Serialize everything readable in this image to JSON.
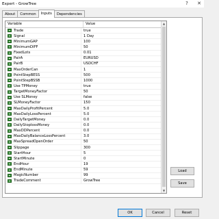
{
  "window": {
    "title": "Expert - GrowTree"
  },
  "tabs": [
    {
      "label": "About"
    },
    {
      "label": "Common"
    },
    {
      "label": "Inputs"
    },
    {
      "label": "Dependencies"
    }
  ],
  "grid": {
    "columns": [
      "Variable",
      "Value"
    ],
    "rows": [
      {
        "name": "Trade",
        "value": "true"
      },
      {
        "name": "Signal",
        "value": "1 Day"
      },
      {
        "name": "MinimumGAP",
        "value": "100"
      },
      {
        "name": "MinimumDIFF",
        "value": "50"
      },
      {
        "name": "FixedLots",
        "value": "0.01"
      },
      {
        "name": "PairA",
        "value": "EURUSD"
      },
      {
        "name": "PairB",
        "value": "USDCHF"
      },
      {
        "name": "MaxOrderCan",
        "value": "1"
      },
      {
        "name": "PointStepBESS",
        "value": "500"
      },
      {
        "name": "PointStepBSSB",
        "value": "1000"
      },
      {
        "name": "Use TPMoney",
        "value": "true"
      },
      {
        "name": "TargetMoneyFactor",
        "value": "50"
      },
      {
        "name": "Use SLMoney",
        "value": "false"
      },
      {
        "name": "SLMoneyFactor",
        "value": "150"
      },
      {
        "name": "MaxDailyProfitPercent",
        "value": "5.0"
      },
      {
        "name": "MaxDailyLossPercent",
        "value": "5.0"
      },
      {
        "name": "DailyTargetMoney",
        "value": "0.0"
      },
      {
        "name": "DailyStoplossMoney",
        "value": "0.0"
      },
      {
        "name": "MaxDDPercent",
        "value": "0.0"
      },
      {
        "name": "MaxDailyBalanceLossPercent",
        "value": "3.0"
      },
      {
        "name": "MaxSpreadOpenOrder",
        "value": "50"
      },
      {
        "name": "Slippage",
        "value": "300"
      },
      {
        "name": "StartHour",
        "value": "5"
      },
      {
        "name": "StartMinute",
        "value": "0"
      },
      {
        "name": "EndHour",
        "value": "19"
      },
      {
        "name": "EndMinute",
        "value": "59"
      },
      {
        "name": "MagicNumber",
        "value": "99"
      },
      {
        "name": "TradeComment",
        "value": "GrowTree"
      }
    ]
  },
  "side_buttons": {
    "load": "Load",
    "save": "Save"
  },
  "bottom_buttons": {
    "ok": "OK",
    "cancel": "Cancel",
    "reset": "Reset"
  }
}
